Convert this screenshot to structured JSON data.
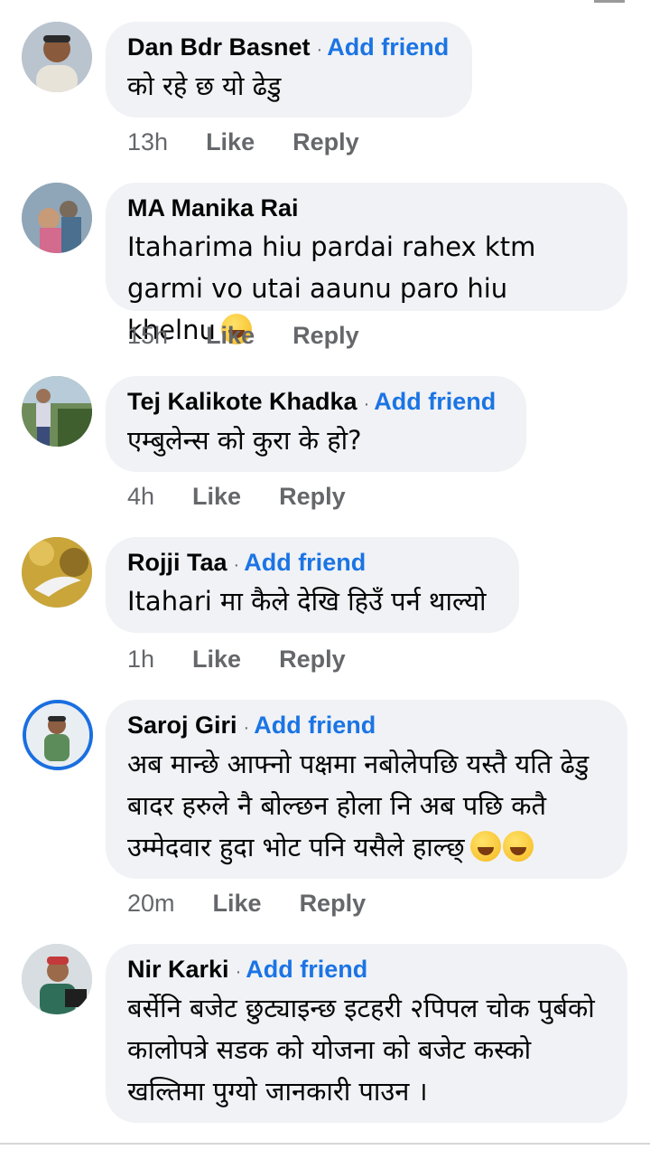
{
  "add_friend_label": "Add friend",
  "like_label": "Like",
  "reply_label": "Reply",
  "comments": [
    {
      "name": "Dan Bdr Basnet",
      "show_add_friend": true,
      "text": "को रहे छ यो ढेडु",
      "time": "13h"
    },
    {
      "name": "MA Manika Rai",
      "show_add_friend": false,
      "text": "Itaharima hiu pardai rahex ktm garmi vo utai aaunu paro hiu khelnu",
      "time": "15h"
    },
    {
      "name": "Tej Kalikote Khadka",
      "show_add_friend": true,
      "text": "एम्बुलेन्स को कुरा के हो?",
      "time": "4h"
    },
    {
      "name": "Rojji Taa",
      "show_add_friend": true,
      "text": "Itahari मा कैले देखि हिउँ पर्न थाल्यो",
      "time": "1h"
    },
    {
      "name": "Saroj Giri",
      "show_add_friend": true,
      "text": "अब मान्छे आफ्नो पक्षमा नबोलेपछि यस्तै यति ढेडु बादर हरुले नै बोल्छन होला नि अब पछि कतै उम्मेदवार हुदा भोट पनि यसैले हाल्छ्",
      "time": "20m"
    },
    {
      "name": "Nir Karki",
      "show_add_friend": true,
      "text": "बर्सेनि बजेट छुट्याइन्छ इटहरी २पिपल चोक पुर्बको कालोपत्रे सडक को योजना को बजेट कस्को खल्तिमा पुग्यो जानकारी पाउन ।",
      "time": ""
    }
  ]
}
